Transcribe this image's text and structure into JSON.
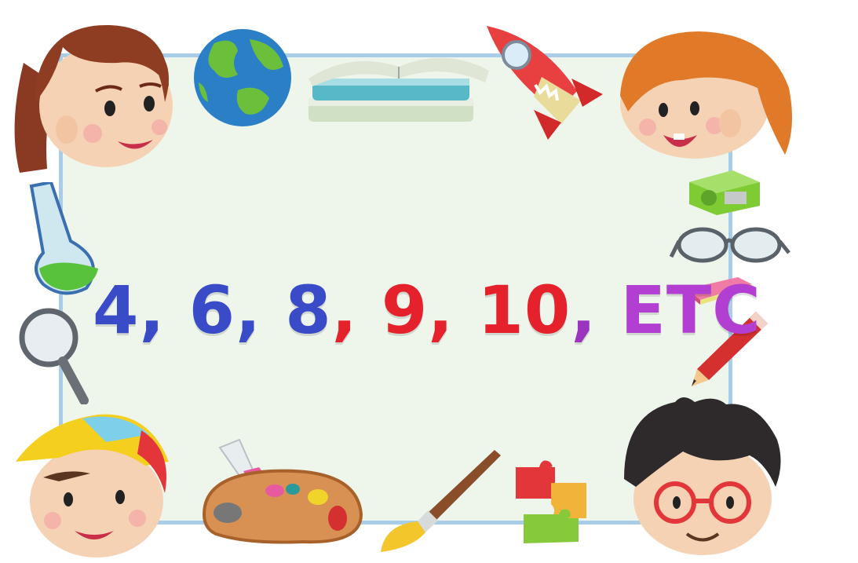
{
  "headline": {
    "tokens": [
      {
        "text": "4",
        "color": "#3a4bc8"
      },
      {
        "text": ", ",
        "color": "#3a4bc8"
      },
      {
        "text": "6",
        "color": "#3a4bc8"
      },
      {
        "text": ", ",
        "color": "#3a4bc8"
      },
      {
        "text": "8",
        "color": "#3a4bc8"
      },
      {
        "text": ", ",
        "color": "#e5212b"
      },
      {
        "text": "9",
        "color": "#e5212b"
      },
      {
        "text": ", ",
        "color": "#e5212b"
      },
      {
        "text": "10",
        "color": "#e5212b"
      },
      {
        "text": ", ",
        "color": "#9b35c0"
      },
      {
        "text": "ETC",
        "color": "#b23fd1"
      }
    ]
  },
  "colors": {
    "board_fill": "#eef6ec",
    "board_border": "#a9cde8"
  },
  "decorations": [
    "girl-brown-hair-icon",
    "globe-icon",
    "books-icon",
    "rocket-icon",
    "girl-orange-hair-icon",
    "flask-icon",
    "pencil-sharpener-icon",
    "glasses-icon",
    "magnifier-icon",
    "eraser-icon",
    "pencil-icon",
    "boy-cap-icon",
    "paint-palette-icon",
    "paintbrush-icon",
    "puzzle-pieces-icon",
    "boy-glasses-icon"
  ]
}
